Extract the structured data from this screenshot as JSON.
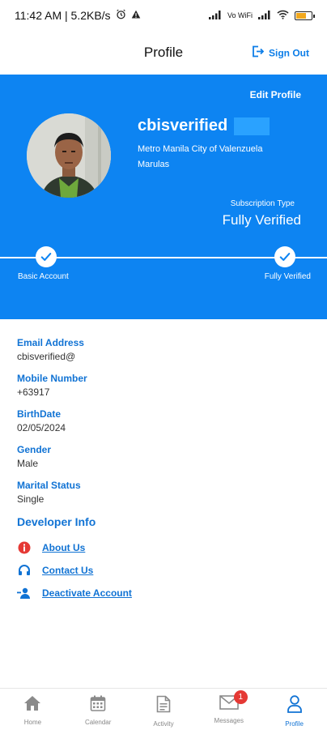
{
  "status": {
    "time_speed": "11:42 AM | 5.2KB/s",
    "volte": "Vo WiFi"
  },
  "header": {
    "title": "Profile",
    "sign_out": "Sign Out"
  },
  "profile": {
    "edit_label": "Edit Profile",
    "username": "cbisverified",
    "address_line1": "Metro Manila City of Valenzuela",
    "address_line2": "Marulas",
    "subscription_label": "Subscription Type",
    "subscription_value": "Fully Verified",
    "step_left": "Basic Account",
    "step_right": "Fully Verified",
    "progress_fraction": 1.0
  },
  "fields": [
    {
      "label": "Email Address",
      "value": "cbisverified@"
    },
    {
      "label": "Mobile Number",
      "value": "+63917"
    },
    {
      "label": "BirthDate",
      "value": "02/05/2024"
    },
    {
      "label": "Gender",
      "value": "Male"
    },
    {
      "label": "Marital Status",
      "value": "Single"
    }
  ],
  "developer": {
    "title": "Developer Info",
    "items": [
      {
        "label": "About Us",
        "icon": "info-icon",
        "color": "#e53935"
      },
      {
        "label": "Contact Us",
        "icon": "headset-icon",
        "color": "#1173d4"
      },
      {
        "label": "Deactivate Account",
        "icon": "remove-user-icon",
        "color": "#1173d4"
      }
    ]
  },
  "nav": {
    "items": [
      {
        "label": "Home",
        "icon": "home-icon"
      },
      {
        "label": "Calendar",
        "icon": "calendar-icon"
      },
      {
        "label": "Activity",
        "icon": "document-icon"
      },
      {
        "label": "Messages",
        "icon": "mail-icon",
        "badge": "1"
      },
      {
        "label": "Profile",
        "icon": "user-icon",
        "active": true
      }
    ]
  },
  "colors": {
    "accent": "#0d84f2",
    "link": "#1173d4",
    "badge": "#e53935"
  }
}
